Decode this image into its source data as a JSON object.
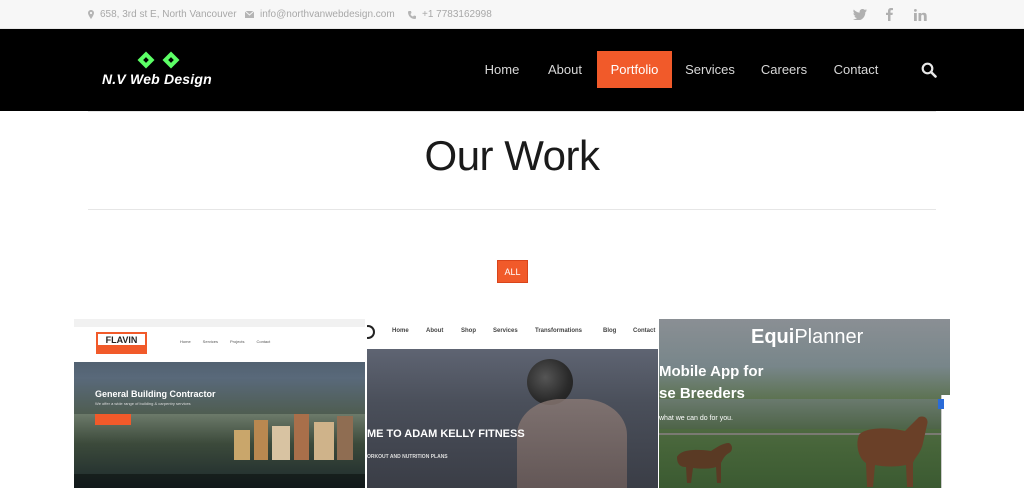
{
  "topbar": {
    "address": "658, 3rd st E, North Vancouver",
    "email": "info@northvanwebdesign.com",
    "phone": "+1 7783162998",
    "social": [
      "twitter-icon",
      "facebook-icon",
      "linkedin-icon"
    ]
  },
  "nav": {
    "logo_text": "N.V Web Design",
    "items": [
      "Home",
      "About",
      "Portfolio",
      "Services",
      "Careers",
      "Contact"
    ],
    "active_index": 2
  },
  "page": {
    "title": "Our Work",
    "filter_all": "ALL"
  },
  "portfolio": [
    {
      "logo_top": "FLAVIN",
      "logo_bottom": "CONSTRUCTION",
      "heading": "General Building Contractor",
      "sub": "We offer a wide range of building & carpentry services",
      "nav": [
        "Home",
        "Services",
        "Projects",
        "Contact"
      ]
    },
    {
      "nav": [
        "Home",
        "About",
        "Shop",
        "Services",
        "Transformations",
        "Blog",
        "Contact"
      ],
      "heading": "ME TO ADAM KELLY FITNESS",
      "sub": "ORKOUT AND NUTRITION PLANS"
    },
    {
      "brand_light": "Equi",
      "brand_bold": "Planner",
      "line1": "Mobile App for",
      "line2": "se Breeders",
      "sub": "what we can do for you."
    }
  ],
  "colors": {
    "accent": "#f15a2a",
    "navbar": "#000000",
    "logo_green": "#5cff66"
  }
}
